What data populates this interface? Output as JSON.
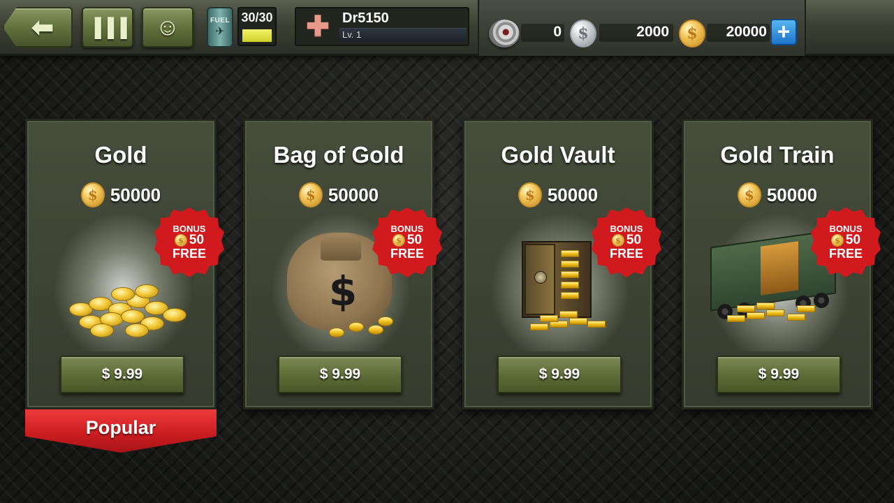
{
  "topbar": {
    "back_icon": "back-arrow-icon",
    "rank_icon": "rank-icon",
    "friends_icon": "friends-icon",
    "fuel": {
      "label": "FUEL",
      "value": "30/30",
      "fraction": 1.0
    },
    "player": {
      "name": "Dr5150",
      "level": "Lv. 1"
    },
    "currencies": {
      "item_count": "0",
      "silver": "2000",
      "gold": "20000"
    },
    "coin_symbol": "$",
    "plus_label": "+"
  },
  "offers": [
    {
      "title": "Gold",
      "amount": "50000",
      "bonus_label": "BONUS",
      "bonus_amount": "50",
      "bonus_free": "FREE",
      "price": "$ 9.99"
    },
    {
      "title": "Bag of Gold",
      "amount": "50000",
      "bonus_label": "BONUS",
      "bonus_amount": "50",
      "bonus_free": "FREE",
      "price": "$ 9.99"
    },
    {
      "title": "Gold Vault",
      "amount": "50000",
      "bonus_label": "BONUS",
      "bonus_amount": "50",
      "bonus_free": "FREE",
      "price": "$ 9.99"
    },
    {
      "title": "Gold Train",
      "amount": "50000",
      "bonus_label": "BONUS",
      "bonus_amount": "50",
      "bonus_free": "FREE",
      "price": "$ 9.99"
    }
  ],
  "popular_label": "Popular",
  "colors": {
    "accent_green": "#5f6f3b",
    "badge_red": "#d11a1d",
    "gold": "#f2c65a",
    "plus_blue": "#1f74c8"
  }
}
